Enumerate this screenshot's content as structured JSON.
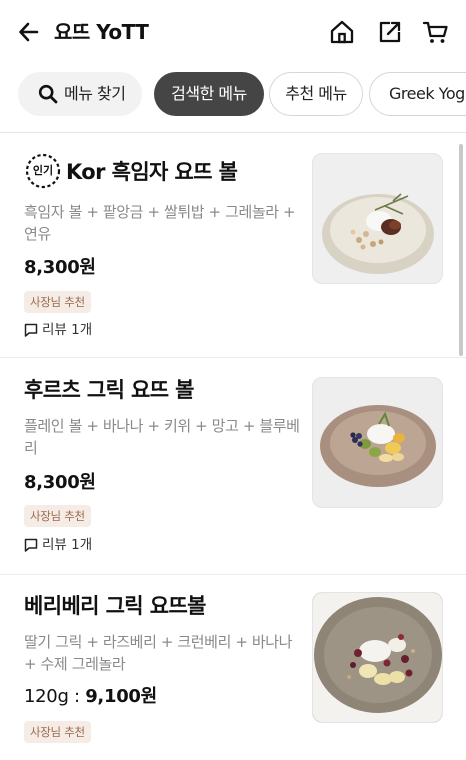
{
  "header": {
    "title": "요뜨 YoTT",
    "icons": [
      "back-arrow-icon",
      "home-icon",
      "share-icon",
      "cart-icon"
    ]
  },
  "chips": {
    "search_label": "메뉴 찾기",
    "searched_label": "검색한 메뉴",
    "recommended_label": "추천 메뉴",
    "greek_label": "Greek Yog"
  },
  "items": [
    {
      "popular_badge": "인기",
      "name": "Kor 흑임자 요뜨 볼",
      "desc": "흑임자 볼 + 팥앙금 + 쌀튀밥 + 그레놀라 + 연유",
      "price": "8,300원",
      "badge": "사장님 추천",
      "review": "리뷰 1개"
    },
    {
      "name": "후르츠 그릭 요뜨 볼",
      "desc": "플레인 볼 + 바나나 + 키위 + 망고 + 블루베리",
      "price": "8,300원",
      "badge": "사장님 추천",
      "review": "리뷰 1개"
    },
    {
      "name": "베리베리 그릭 요뜨볼",
      "desc": "딸기 그릭 + 라즈베리 + 크런베리 + 바나나 + 수제 그레놀라",
      "weight": "120g : ",
      "price": "9,100원",
      "badge": "사장님 추천"
    }
  ],
  "colors": {
    "active_chip": "#454545",
    "badge_bg": "#f6ece6",
    "badge_text": "#9a6a4d"
  }
}
